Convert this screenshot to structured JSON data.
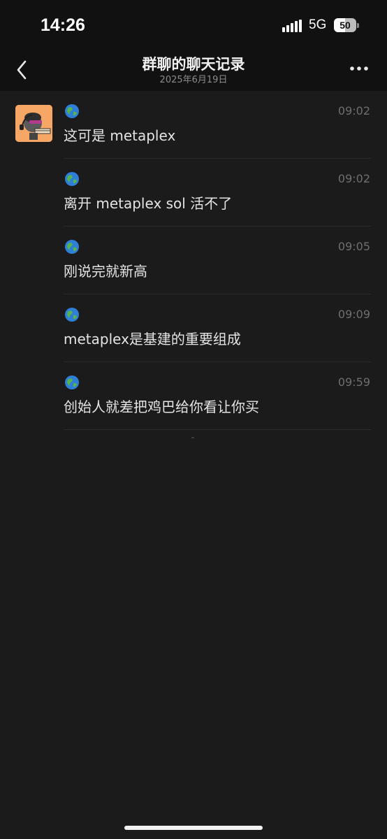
{
  "status_bar": {
    "time": "14:26",
    "network": "5G",
    "battery": "50",
    "battery_level": 0.5
  },
  "nav": {
    "title": "群聊的聊天记录",
    "subtitle": "2025年6月19日",
    "back_icon": "chevron-left-icon",
    "more_icon": "ellipsis-icon"
  },
  "messages": [
    {
      "time": "09:02",
      "text": "这可是 metaplex",
      "sender_icon": "globe-icon"
    },
    {
      "time": "09:02",
      "text": "离开 metaplex sol 活不了",
      "sender_icon": "globe-icon"
    },
    {
      "time": "09:05",
      "text": "刚说完就新高",
      "sender_icon": "globe-icon"
    },
    {
      "time": "09:09",
      "text": "metaplex是基建的重要组成",
      "sender_icon": "globe-icon"
    },
    {
      "time": "09:59",
      "text": "创始人就差把鸡巴给你看让你买",
      "sender_icon": "globe-icon"
    }
  ],
  "colors": {
    "background": "#1b1b1b",
    "header": "#111111",
    "text": "#e4e4e4",
    "time": "#6f6f6f",
    "avatar": "#f6a766"
  }
}
